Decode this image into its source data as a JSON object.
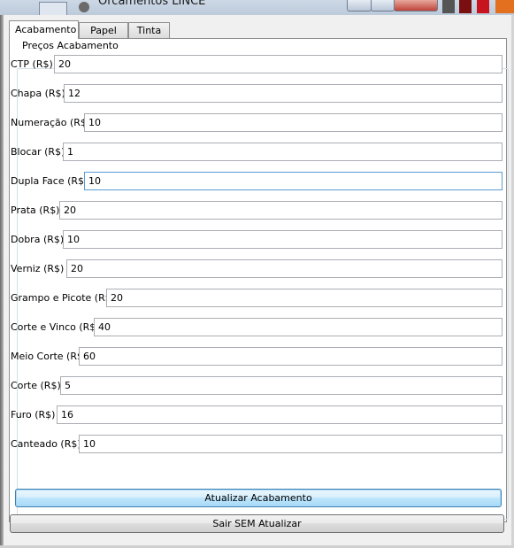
{
  "window": {
    "title": "Orcamentos LINCE"
  },
  "tabs": [
    {
      "label": "Acabamento",
      "active": true
    },
    {
      "label": "Papel",
      "active": false
    },
    {
      "label": "Tinta",
      "active": false
    }
  ],
  "group": {
    "title": "Preços Acabamento"
  },
  "fields": [
    {
      "label": "CTP (R$)",
      "value": "20"
    },
    {
      "label": "Chapa (R$)",
      "value": "12"
    },
    {
      "label": "Numeração (R$)",
      "value": "10"
    },
    {
      "label": "Blocar (R$)",
      "value": "1"
    },
    {
      "label": "Dupla Face (R$)",
      "value": "10",
      "focused": true
    },
    {
      "label": "Prata (R$)",
      "value": "20"
    },
    {
      "label": "Dobra (R$)",
      "value": "10"
    },
    {
      "label": "Verniz (R$)",
      "value": "20"
    },
    {
      "label": "Grampo e Picote (R$)",
      "value": "20"
    },
    {
      "label": "Corte e Vinco (R$)",
      "value": "40"
    },
    {
      "label": "Meio Corte (R$)",
      "value": "60"
    },
    {
      "label": "Corte (R$)",
      "value": "5"
    },
    {
      "label": "Furo (R$)",
      "value": "16"
    },
    {
      "label": "Canteado (R$)",
      "value": "10"
    }
  ],
  "buttons": {
    "update_label": "Atualizar Acabamento",
    "exit_label": "Sair SEM Atualizar"
  },
  "colors": {
    "focus_border": "#5a9bd5",
    "default_button": "#3c7fb1"
  }
}
